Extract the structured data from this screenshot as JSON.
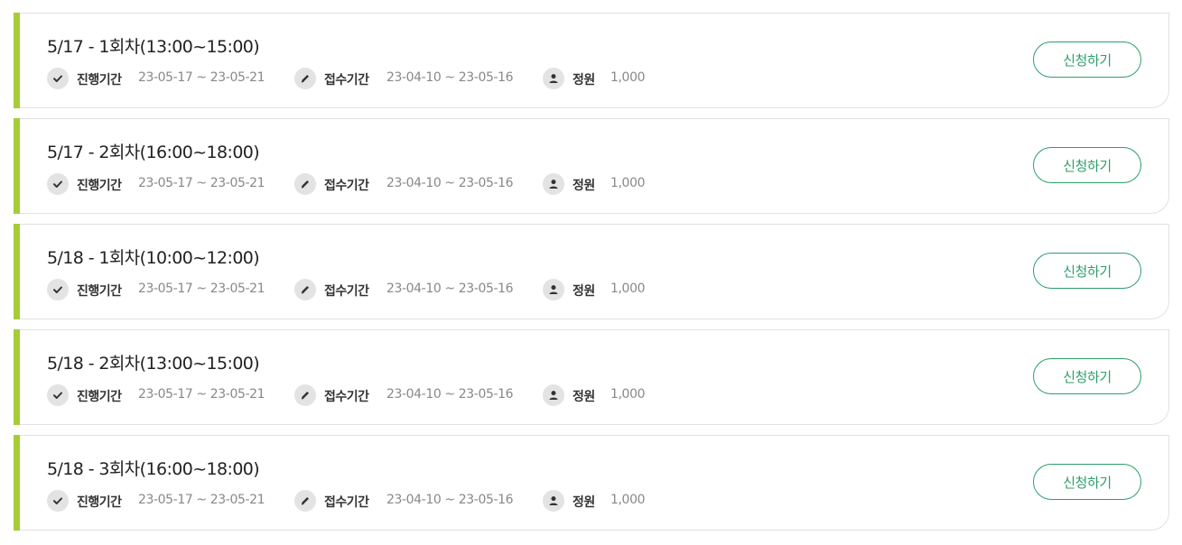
{
  "sessions": [
    {
      "title": "5/17 - 1회차(13:00~15:00)",
      "period_label": "진행기간",
      "period_value": "23-05-17 ~ 23-05-21",
      "reg_label": "접수기간",
      "reg_value": "23-04-10 ~ 23-05-16",
      "cap_label": "정원",
      "cap_value": "1,000",
      "button_label": "신청하기"
    },
    {
      "title": "5/17 - 2회차(16:00~18:00)",
      "period_label": "진행기간",
      "period_value": "23-05-17 ~ 23-05-21",
      "reg_label": "접수기간",
      "reg_value": "23-04-10 ~ 23-05-16",
      "cap_label": "정원",
      "cap_value": "1,000",
      "button_label": "신청하기"
    },
    {
      "title": "5/18 - 1회차(10:00~12:00)",
      "period_label": "진행기간",
      "period_value": "23-05-17 ~ 23-05-21",
      "reg_label": "접수기간",
      "reg_value": "23-04-10 ~ 23-05-16",
      "cap_label": "정원",
      "cap_value": "1,000",
      "button_label": "신청하기"
    },
    {
      "title": "5/18 - 2회차(13:00~15:00)",
      "period_label": "진행기간",
      "period_value": "23-05-17 ~ 23-05-21",
      "reg_label": "접수기간",
      "reg_value": "23-04-10 ~ 23-05-16",
      "cap_label": "정원",
      "cap_value": "1,000",
      "button_label": "신청하기"
    },
    {
      "title": "5/18 - 3회차(16:00~18:00)",
      "period_label": "진행기간",
      "period_value": "23-05-17 ~ 23-05-21",
      "reg_label": "접수기간",
      "reg_value": "23-04-10 ~ 23-05-16",
      "cap_label": "정원",
      "cap_value": "1,000",
      "button_label": "신청하기"
    }
  ],
  "icons": {
    "period": "check-icon",
    "registration": "pencil-icon",
    "capacity": "person-icon"
  },
  "colors": {
    "accent_bar": "#a5cd37",
    "button": "#2e9e6a",
    "icon_bg": "#e3e3e3"
  }
}
